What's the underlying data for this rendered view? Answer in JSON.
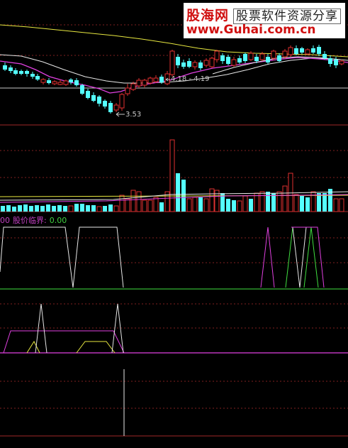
{
  "watermark": {
    "site_name": "股海网",
    "subtitle": "股票软件资源分享",
    "url": "www.Guhai.com.cn"
  },
  "price_panel": {
    "annotations": {
      "low_marker": "3.53",
      "range_marker": "4.18 - 4.19"
    }
  },
  "indicator_panel": {
    "code": "00",
    "name": "股价临界:",
    "value": "0.00"
  },
  "colors": {
    "background": "#000000",
    "up_candle": "#e03030",
    "down_candle": "#54ffff",
    "ma_white": "#e8e8e8",
    "ma_yellow": "#e8e840",
    "ma_magenta": "#e040e0",
    "separator": "#a02828",
    "green_line": "#40e040"
  }
}
